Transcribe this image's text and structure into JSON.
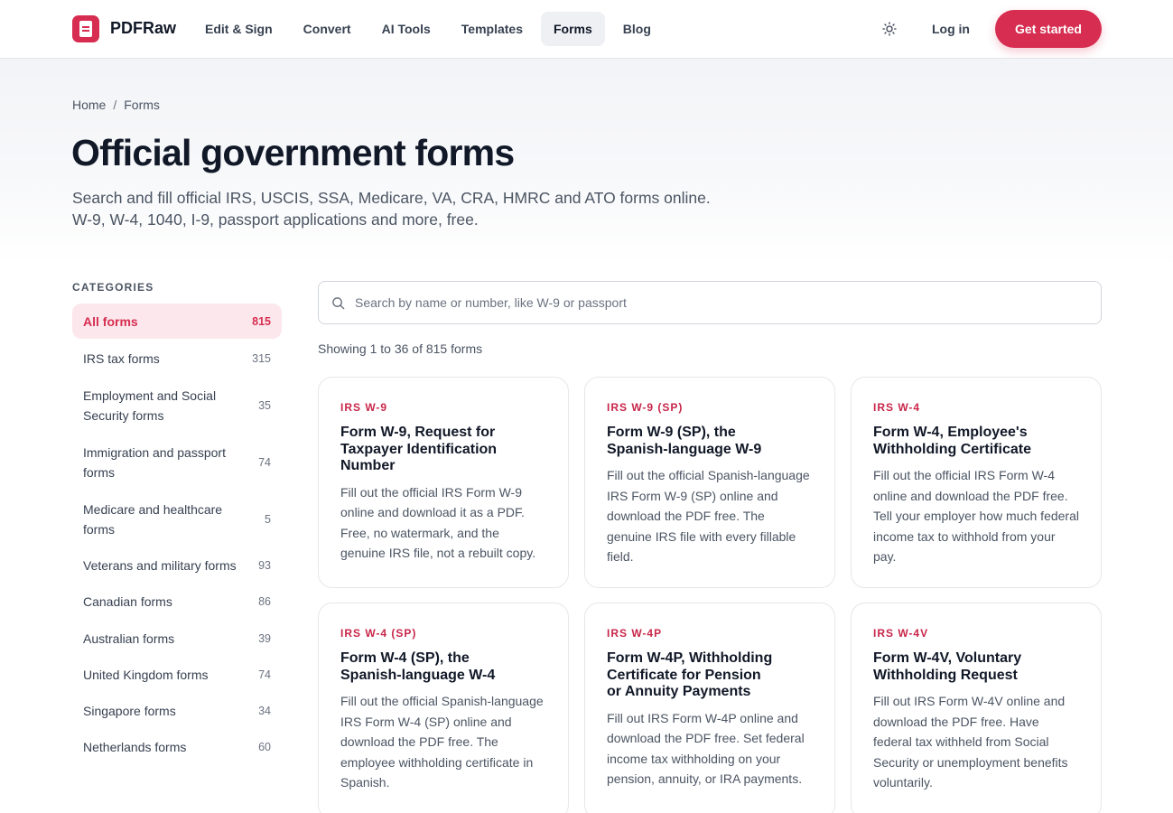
{
  "header": {
    "brand": "PDFRaw",
    "nav": [
      {
        "label": "Edit & Sign",
        "active": false
      },
      {
        "label": "Convert",
        "active": false
      },
      {
        "label": "AI Tools",
        "active": false
      },
      {
        "label": "Templates",
        "active": false
      },
      {
        "label": "Forms",
        "active": true
      },
      {
        "label": "Blog",
        "active": false
      }
    ],
    "theme_icon": "sun-icon",
    "login_label": "Log in",
    "cta_label": "Get started"
  },
  "breadcrumb": {
    "items": [
      "Home",
      "Forms"
    ],
    "separator": "/"
  },
  "hero": {
    "title": "Official government forms",
    "subtitle_line1": "Search and fill official IRS, USCIS, SSA, Medicare, VA, CRA, HMRC and ATO forms online.",
    "subtitle_line2": "W-9, W-4, 1040, I-9, passport applications and more, free."
  },
  "sidebar": {
    "heading": "CATEGORIES",
    "items": [
      {
        "label": "All forms",
        "count": "815",
        "active": true
      },
      {
        "label": "IRS tax forms",
        "count": "315",
        "active": false
      },
      {
        "label": "Employment and Social Security forms",
        "count": "35",
        "active": false
      },
      {
        "label": "Immigration and passport forms",
        "count": "74",
        "active": false
      },
      {
        "label": "Medicare and healthcare forms",
        "count": "5",
        "active": false
      },
      {
        "label": "Veterans and military forms",
        "count": "93",
        "active": false
      },
      {
        "label": "Canadian forms",
        "count": "86",
        "active": false
      },
      {
        "label": "Australian forms",
        "count": "39",
        "active": false
      },
      {
        "label": "United Kingdom forms",
        "count": "74",
        "active": false
      },
      {
        "label": "Singapore forms",
        "count": "34",
        "active": false
      },
      {
        "label": "Netherlands forms",
        "count": "60",
        "active": false
      }
    ]
  },
  "search": {
    "placeholder": "Search by name or number, like W-9 or passport",
    "value": ""
  },
  "results": {
    "summary": "Showing 1 to 36 of 815 forms"
  },
  "cards": [
    {
      "code": "IRS W-9",
      "title": "Form W-9, Request for Taxpayer Identification Number",
      "desc": "Fill out the official IRS Form W-9 online and download it as a PDF. Free, no watermark, and the genuine IRS file, not a rebuilt copy."
    },
    {
      "code": "IRS W-9 (SP)",
      "title": "Form W-9 (SP), the Spanish-language W-9",
      "desc": "Fill out the official Spanish-language IRS Form W-9 (SP) online and download the PDF free. The genuine IRS file with every fillable field."
    },
    {
      "code": "IRS W-4",
      "title": "Form W-4, Employee's Withholding Certificate",
      "desc": "Fill out the official IRS Form W-4 online and download the PDF free. Tell your employer how much federal income tax to withhold from your pay."
    },
    {
      "code": "IRS W-4 (SP)",
      "title": "Form W-4 (SP), the Spanish-language W-4",
      "desc": "Fill out the official Spanish-language IRS Form W-4 (SP) online and download the PDF free. The employee withholding certificate in Spanish."
    },
    {
      "code": "IRS W-4P",
      "title": "Form W-4P, Withholding Certificate for Pension or Annuity Payments",
      "desc": "Fill out IRS Form W-4P online and download the PDF free. Set federal income tax withholding on your pension, annuity, or IRA payments."
    },
    {
      "code": "IRS W-4V",
      "title": "Form W-4V, Voluntary Withholding Request",
      "desc": "Fill out IRS Form W-4V online and download the PDF free. Have federal tax withheld from Social Security or unemployment benefits voluntarily."
    }
  ],
  "colors": {
    "accent": "#d62d50",
    "accent_soft": "#fce8ec",
    "text": "#111827",
    "muted": "#4b5563",
    "border": "#e5e7eb"
  }
}
